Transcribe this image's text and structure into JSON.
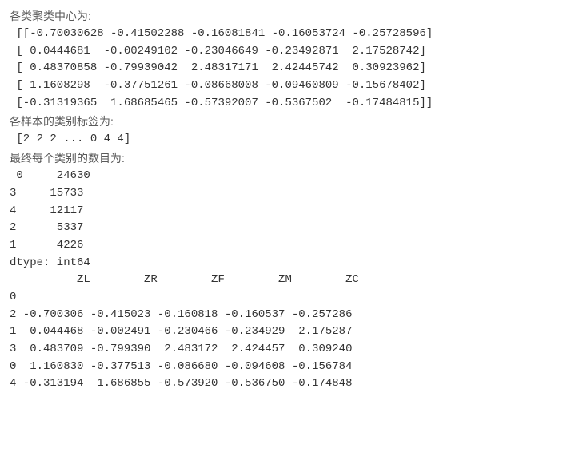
{
  "labels": {
    "cluster_centers": "各类聚类中心为:",
    "sample_labels": "各样本的类别标签为:",
    "final_counts": "最终每个类别的数目为:"
  },
  "cluster_centers_block": " [[-0.70030628 -0.41502288 -0.16081841 -0.16053724 -0.25728596]\n [ 0.0444681  -0.00249102 -0.23046649 -0.23492871  2.17528742]\n [ 0.48370858 -0.79939042  2.48317171  2.42445742  0.30923962]\n [ 1.1608298  -0.37751261 -0.08668008 -0.09460809 -0.15678402]\n [-0.31319365  1.68685465 -0.57392007 -0.5367502  -0.17484815]]",
  "sample_labels_line": " [2 2 2 ... 0 4 4]",
  "counts_block": " 0     24630\n3     15733\n4     12117\n2      5337\n1      4226\ndtype: int64",
  "table_block": "          ZL        ZR        ZF        ZM        ZC\n0                                                  \n2 -0.700306 -0.415023 -0.160818 -0.160537 -0.257286\n1  0.044468 -0.002491 -0.230466 -0.234929  2.175287\n3  0.483709 -0.799390  2.483172  2.424457  0.309240\n0  1.160830 -0.377513 -0.086680 -0.094608 -0.156784\n4 -0.313194  1.686855 -0.573920 -0.536750 -0.174848",
  "chart_data": {
    "type": "table",
    "title": "",
    "cluster_centers": {
      "rows": [
        [
          -0.70030628,
          -0.41502288,
          -0.16081841,
          -0.16053724,
          -0.25728596
        ],
        [
          0.0444681,
          -0.00249102,
          -0.23046649,
          -0.23492871,
          2.17528742
        ],
        [
          0.48370858,
          -0.79939042,
          2.48317171,
          2.42445742,
          0.30923962
        ],
        [
          1.1608298,
          -0.37751261,
          -0.08668008,
          -0.09460809,
          -0.15678402
        ],
        [
          -0.31319365,
          1.68685465,
          -0.57392007,
          -0.5367502,
          -0.17484815
        ]
      ]
    },
    "sample_labels_preview": [
      2,
      2,
      2,
      "...",
      0,
      4,
      4
    ],
    "category_counts": {
      "0": 24630,
      "3": 15733,
      "4": 12117,
      "2": 5337,
      "1": 4226,
      "dtype": "int64"
    },
    "summary_table": {
      "index_name": "0",
      "columns": [
        "ZL",
        "ZR",
        "ZF",
        "ZM",
        "ZC"
      ],
      "rows": [
        {
          "idx": 2,
          "ZL": -0.700306,
          "ZR": -0.415023,
          "ZF": -0.160818,
          "ZM": -0.160537,
          "ZC": -0.257286
        },
        {
          "idx": 1,
          "ZL": 0.044468,
          "ZR": -0.002491,
          "ZF": -0.230466,
          "ZM": -0.234929,
          "ZC": 2.175287
        },
        {
          "idx": 3,
          "ZL": 0.483709,
          "ZR": -0.79939,
          "ZF": 2.483172,
          "ZM": 2.424457,
          "ZC": 0.30924
        },
        {
          "idx": 0,
          "ZL": 1.16083,
          "ZR": -0.377513,
          "ZF": -0.08668,
          "ZM": -0.094608,
          "ZC": -0.156784
        },
        {
          "idx": 4,
          "ZL": -0.313194,
          "ZR": 1.686855,
          "ZF": -0.57392,
          "ZM": -0.53675,
          "ZC": -0.174848
        }
      ]
    }
  }
}
